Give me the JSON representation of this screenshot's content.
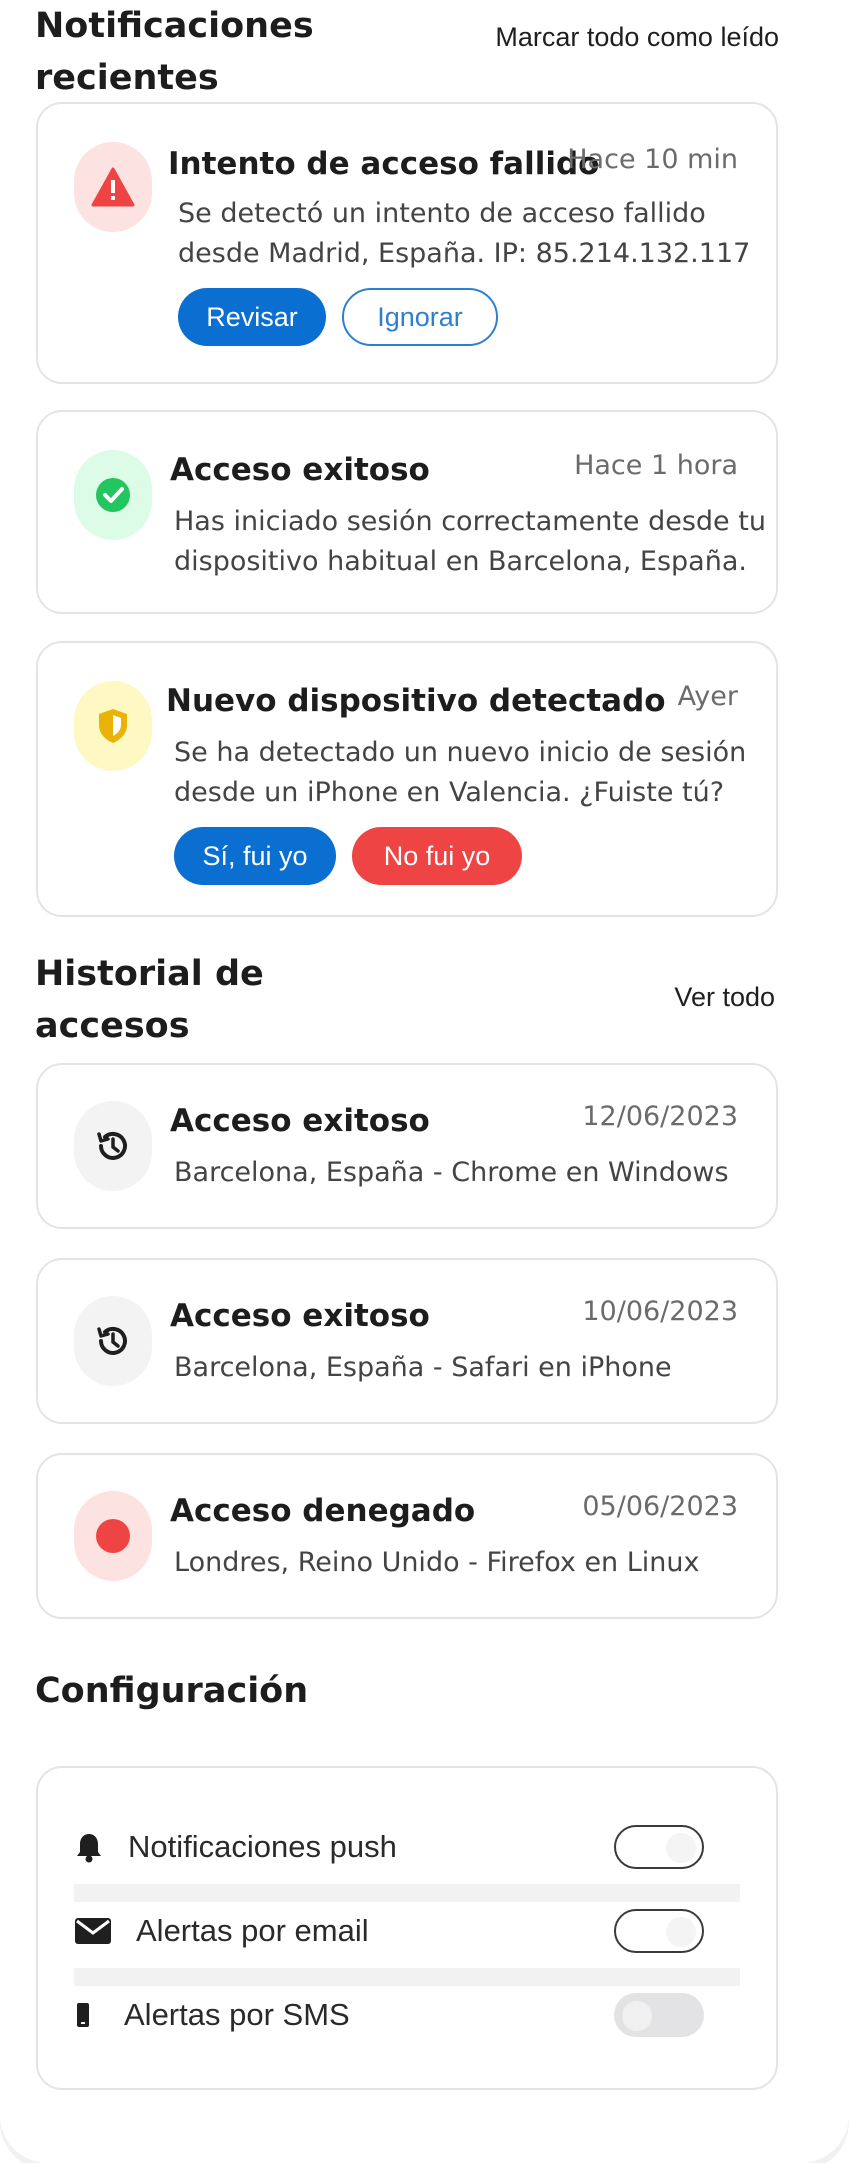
{
  "notifications": {
    "title": "Notificaciones recientes",
    "title_line1": "Notificaciones",
    "title_line2": "recientes",
    "mark_all": "Marcar todo como leído",
    "items": [
      {
        "icon": "warning-triangle-icon",
        "title": "Intento de acceso fallido",
        "time": "Hace 10 min",
        "body_line1": "Se detectó un intento de acceso fallido",
        "body_line2": "desde Madrid, España. IP: 85.214.132.117",
        "actions": [
          "Revisar",
          "Ignorar"
        ]
      },
      {
        "icon": "check-circle-icon",
        "title": "Acceso exitoso",
        "time": "Hace 1 hora",
        "body_line1": "Has iniciado sesión correctamente desde tu",
        "body_line2": "dispositivo habitual en Barcelona, España."
      },
      {
        "icon": "shield-icon",
        "title": "Nuevo dispositivo detectado",
        "time": "Ayer",
        "body_line1": "Se ha detectado un nuevo inicio de sesión",
        "body_line2": "desde un iPhone en Valencia. ¿Fuiste tú?",
        "actions": [
          "Sí, fui yo",
          "No fui yo"
        ]
      }
    ]
  },
  "history": {
    "title_line1": "Historial de",
    "title_line2": "accesos",
    "view_all": "Ver todo",
    "items": [
      {
        "icon": "history-icon",
        "title": "Acceso exitoso",
        "date": "12/06/2023",
        "desc": "Barcelona, España - Chrome en Windows"
      },
      {
        "icon": "history-icon",
        "title": "Acceso exitoso",
        "date": "10/06/2023",
        "desc": "Barcelona, España - Safari en iPhone"
      },
      {
        "icon": "red-dot-icon",
        "title": "Acceso denegado",
        "date": "05/06/2023",
        "desc": "Londres, Reino Unido - Firefox en Linux"
      }
    ]
  },
  "settings": {
    "title": "Configuración",
    "items": [
      {
        "icon": "bell-icon",
        "label": "Notificaciones push",
        "enabled": true
      },
      {
        "icon": "envelope-icon",
        "label": "Alertas por email",
        "enabled": true
      },
      {
        "icon": "phone-icon",
        "label": "Alertas por SMS",
        "enabled": false
      }
    ]
  },
  "colors": {
    "primary": "#0a6fd0",
    "danger": "#ef4444",
    "success": "#22c55e",
    "warning": "#eab308"
  }
}
